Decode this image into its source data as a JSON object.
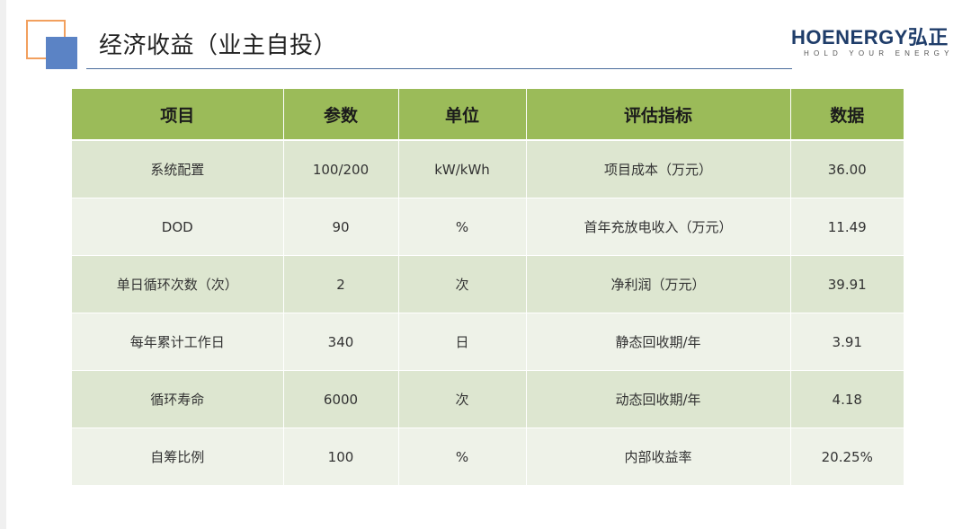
{
  "header": {
    "title": "经济收益（业主自投）",
    "logo_main": "HOENERGY弘正",
    "logo_sub": "HOLD YOUR ENERGY"
  },
  "table": {
    "columns": [
      "项目",
      "参数",
      "单位",
      "评估指标",
      "数据"
    ],
    "rows": [
      [
        "系统配置",
        "100/200",
        "kW/kWh",
        "项目成本（万元）",
        "36.00"
      ],
      [
        "DOD",
        "90",
        "%",
        "首年充放电收入（万元）",
        "11.49"
      ],
      [
        "单日循环次数（次）",
        "2",
        "次",
        "净利润（万元）",
        "39.91"
      ],
      [
        "每年累计工作日",
        "340",
        "日",
        "静态回收期/年",
        "3.91"
      ],
      [
        "循环寿命",
        "6000",
        "次",
        "动态回收期/年",
        "4.18"
      ],
      [
        "自筹比例",
        "100",
        "%",
        "内部收益率",
        "20.25%"
      ]
    ]
  },
  "colors": {
    "header_green": "#9bbb59",
    "row_dark": "#dde6d0",
    "row_light": "#eef2e8",
    "deco_orange": "#f2a05e",
    "deco_blue": "#5b83c5",
    "logo_navy": "#1f3d6a"
  }
}
